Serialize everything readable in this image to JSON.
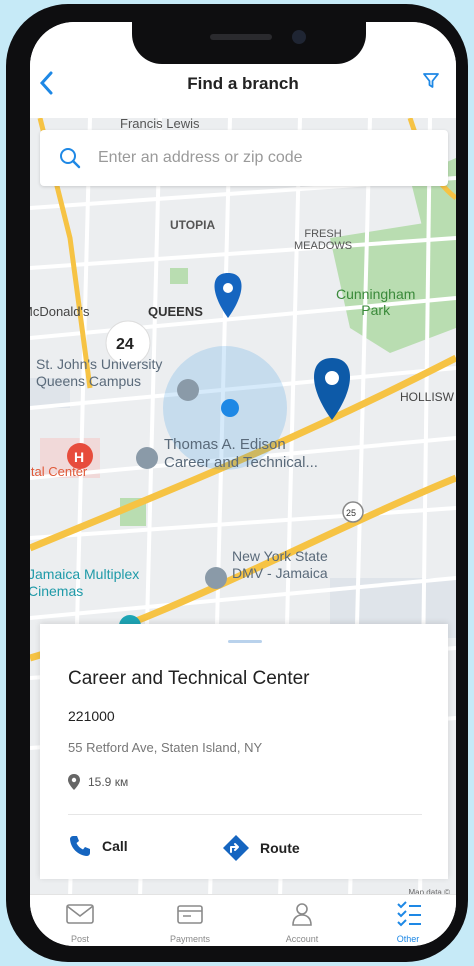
{
  "header": {
    "title": "Find a branch"
  },
  "search": {
    "placeholder": "Enter an address or zip code"
  },
  "map": {
    "labels": {
      "top": "Francis Lewis",
      "utopia": "UTOPIA",
      "fresh_meadows": "FRESH\nMEADOWS",
      "cunningham": "Cunningham\nPark",
      "mcdonalds": "McDonald's",
      "queens": "QUEENS",
      "stjohns": "St. John's University\nQueens Campus",
      "holliswood": "HOLLISW",
      "edison": "Thomas A. Edison\nCareer and Technical...",
      "medical": "ital Center",
      "nys": "New York State\nDMV - Jamaica",
      "jamaica": "Jamaica Multiplex\nCinemas",
      "route_shield": "25",
      "hospital_glyph": "H"
    },
    "cluster_count": "24",
    "attribution": "Map data ©"
  },
  "branch": {
    "name": "Career and Technical Center",
    "code": "221000",
    "address": "55 Retford Ave, Staten Island, NY",
    "distance": "15.9 км",
    "call_label": "Call",
    "route_label": "Route"
  },
  "tabs": [
    {
      "label": "Post",
      "icon": "mail-icon"
    },
    {
      "label": "Payments",
      "icon": "wallet-icon"
    },
    {
      "label": "Account",
      "icon": "person-icon"
    },
    {
      "label": "Other",
      "icon": "list-icon",
      "active": true
    }
  ],
  "colors": {
    "accent": "#1e88e5",
    "pin": "#1565c0",
    "road": "#f6c344",
    "park": "#b9ddb1",
    "background": "#c6eaf7"
  }
}
